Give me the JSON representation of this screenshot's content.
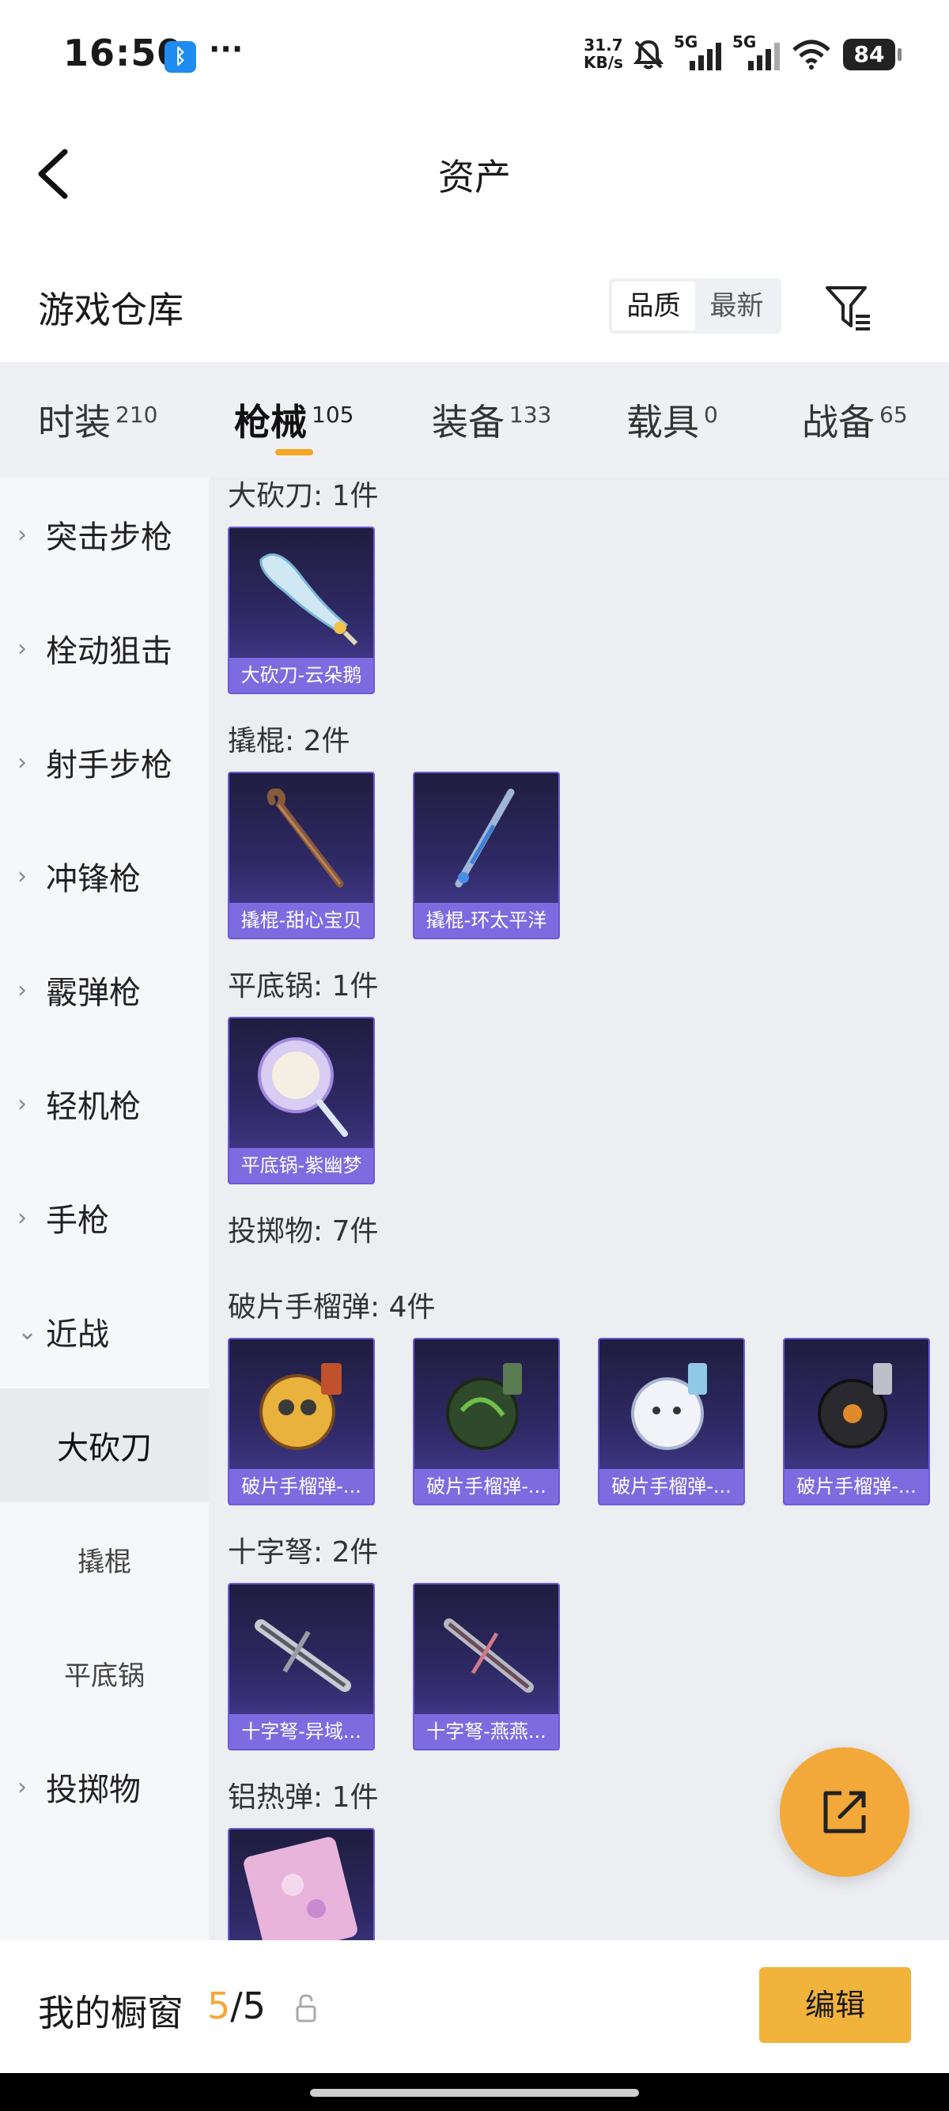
{
  "status_bar": {
    "time": "16:50",
    "bluetooth_icon": "bluetooth-icon",
    "more": "···",
    "net_speed_value": "31.7",
    "net_speed_unit": "KB/s",
    "signal_label_1": "5G",
    "signal_label_2": "5G",
    "battery": "84"
  },
  "header": {
    "title": "资产",
    "back_icon": "back-arrow-icon"
  },
  "warehouse": {
    "title": "游戏仓库",
    "sort_options": [
      "品质",
      "最新"
    ],
    "sort_selected": "品质",
    "filter_icon": "filter-icon"
  },
  "tabs": [
    {
      "label": "时装",
      "count": "210"
    },
    {
      "label": "枪械",
      "count": "105",
      "active": true
    },
    {
      "label": "装备",
      "count": "133"
    },
    {
      "label": "载具",
      "count": "0"
    },
    {
      "label": "战备",
      "count": "65"
    }
  ],
  "sidebar": {
    "items": [
      {
        "label": "突击步枪"
      },
      {
        "label": "栓动狙击"
      },
      {
        "label": "射手步枪"
      },
      {
        "label": "冲锋枪"
      },
      {
        "label": "霰弹枪"
      },
      {
        "label": "轻机枪"
      },
      {
        "label": "手枪"
      },
      {
        "label": "近战",
        "expanded": true
      },
      {
        "label": "大砍刀",
        "sub": true,
        "selected": true
      },
      {
        "label": "撬棍",
        "sub": true
      },
      {
        "label": "平底锅",
        "sub": true
      },
      {
        "label": "投掷物"
      }
    ]
  },
  "groups": [
    {
      "title": "大砍刀: 1件",
      "items": [
        "大砍刀-云朵鹅"
      ]
    },
    {
      "title": "撬棍: 2件",
      "items": [
        "撬棍-甜心宝贝",
        "撬棍-环太平洋"
      ]
    },
    {
      "title": "平底锅: 1件",
      "items": [
        "平底锅-紫幽梦"
      ]
    },
    {
      "title": "投掷物: 7件",
      "items": []
    },
    {
      "title": "破片手榴弹: 4件",
      "items": [
        "破片手榴弹-...",
        "破片手榴弹-...",
        "破片手榴弹-...",
        "破片手榴弹-..."
      ]
    },
    {
      "title": "十字弩: 2件",
      "items": [
        "十字弩-异域...",
        "十字弩-燕燕..."
      ]
    },
    {
      "title": "铝热弹: 1件",
      "items": [
        ""
      ]
    }
  ],
  "bottom_bar": {
    "title": "我的橱窗",
    "current": "5",
    "separator": "/",
    "total": "5",
    "edit_label": "编辑",
    "lock_icon": "lock-icon"
  },
  "fab": {
    "icon": "share-external-icon"
  },
  "colors": {
    "accent": "#f2a93a",
    "card_border": "#6c5bd6",
    "card_label": "#7f6be0",
    "content_bg": "#eceef2"
  }
}
